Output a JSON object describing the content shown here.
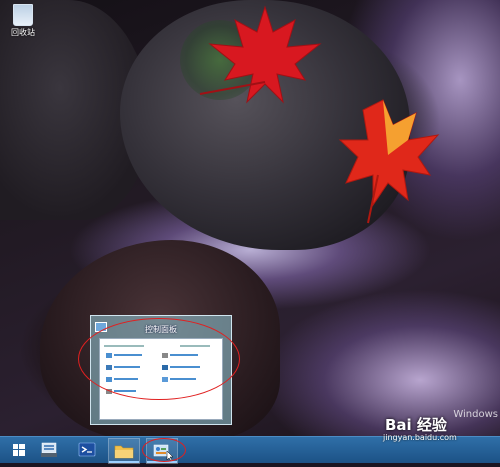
{
  "desktop": {
    "recycle_bin_label": "回收站",
    "windows_watermark": "Windows",
    "baidu_logo": "Bai 经验",
    "baidu_url": "jingyan.baidu.com"
  },
  "thumbnail": {
    "title": "控制面板"
  },
  "taskbar": {
    "items": [
      {
        "icon": "windows-start-icon"
      },
      {
        "icon": "server-manager-icon"
      },
      {
        "icon": "powershell-icon"
      },
      {
        "icon": "file-explorer-icon"
      },
      {
        "icon": "control-panel-icon"
      }
    ]
  },
  "annotation_color": "#e02020"
}
